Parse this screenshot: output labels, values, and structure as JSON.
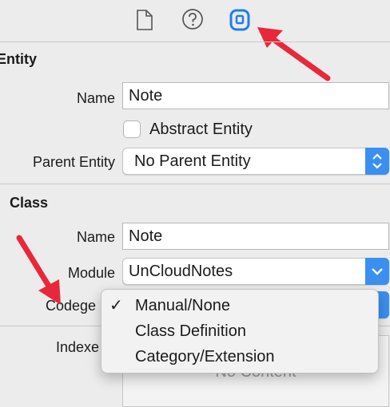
{
  "inspector_tabs": [
    {
      "icon": "file-icon"
    },
    {
      "icon": "help-icon"
    },
    {
      "icon": "data-model-inspector-icon",
      "selected": true
    }
  ],
  "entity": {
    "section_title": "Entity",
    "name_label": "Name",
    "name_value": "Note",
    "abstract_label": "Abstract Entity",
    "abstract_checked": false,
    "parent_label": "Parent Entity",
    "parent_value": "No Parent Entity"
  },
  "class": {
    "section_title": "Class",
    "name_label": "Name",
    "name_value": "Note",
    "module_label": "Module",
    "module_value": "UnCloudNotes",
    "codegen_label": "Codege"
  },
  "indexes": {
    "label": "Indexe",
    "empty_text": "No Content"
  },
  "codegen_menu": {
    "items": [
      {
        "label": "Manual/None",
        "checked": true,
        "check_glyph": "✓"
      },
      {
        "label": "Class Definition",
        "checked": false,
        "check_glyph": ""
      },
      {
        "label": "Category/Extension",
        "checked": false,
        "check_glyph": ""
      }
    ]
  },
  "colors": {
    "accent": "#3b8ff0",
    "annotation_arrow": "#e8283a"
  }
}
